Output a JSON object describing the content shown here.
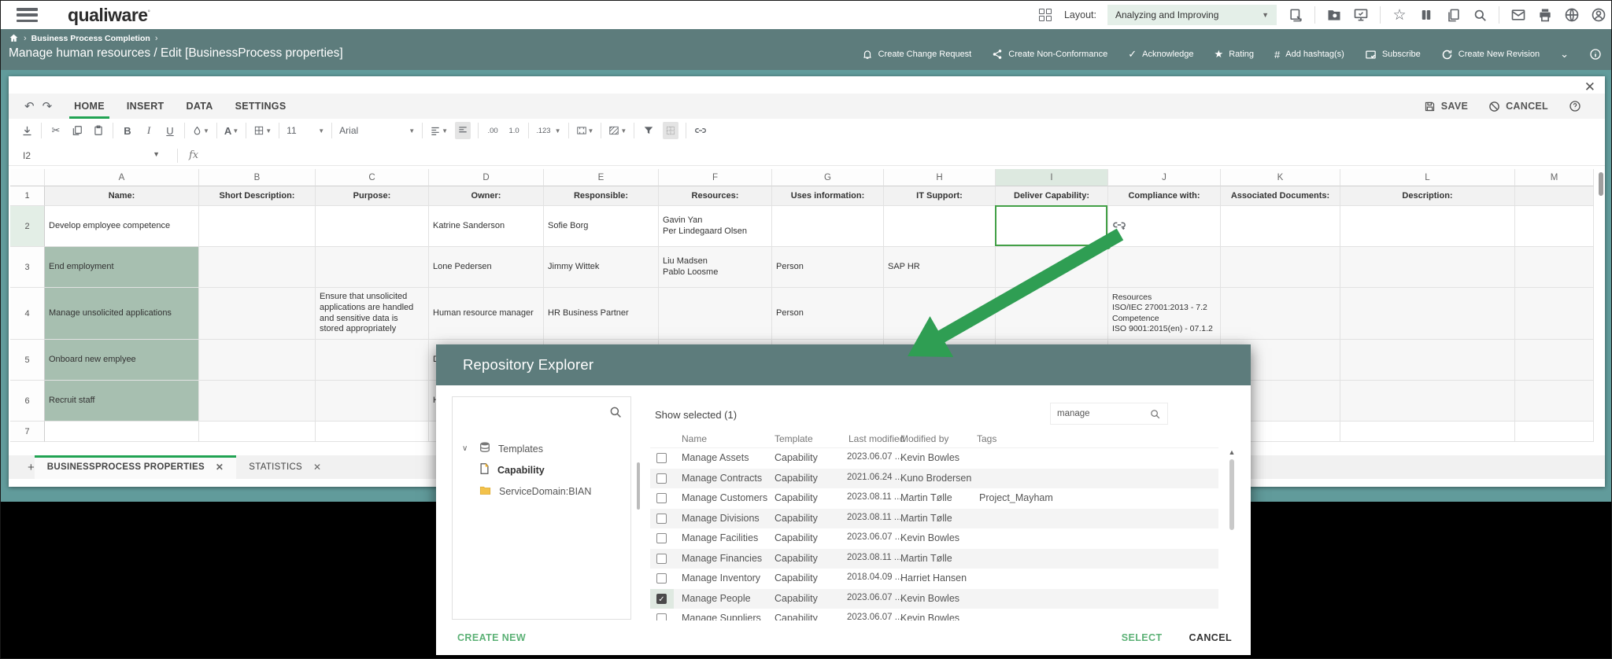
{
  "topbar": {
    "logo": "qualiware",
    "layout_label": "Layout:",
    "layout_value": "Analyzing and Improving"
  },
  "breadcrumb": {
    "path": "Business Process Completion"
  },
  "page": {
    "title": "Manage human resources / Edit [BusinessProcess properties]"
  },
  "actions": {
    "change_request": "Create Change Request",
    "non_conformance": "Create Non-Conformance",
    "acknowledge": "Acknowledge",
    "rating": "Rating",
    "hashtag": "Add hashtag(s)",
    "subscribe": "Subscribe",
    "new_revision": "Create New Revision"
  },
  "editor": {
    "tabs": [
      "HOME",
      "INSERT",
      "DATA",
      "SETTINGS"
    ],
    "active_tab": "HOME",
    "save_label": "SAVE",
    "cancel_label": "CANCEL",
    "font_size": "11",
    "font_name": "Arial",
    "number_format": ".123",
    "cell_ref": "I2",
    "fx_label": "fx",
    "add_sheet": "+",
    "sheet_tabs": [
      "BUSINESSPROCESS PROPERTIES",
      "STATISTICS"
    ],
    "grid": {
      "column_letters": [
        "A",
        "B",
        "C",
        "D",
        "E",
        "F",
        "G",
        "H",
        "I",
        "J",
        "K",
        "L",
        "M"
      ],
      "selected_cell": "I2",
      "headers": [
        "Name:",
        "Short Description:",
        "Purpose:",
        "Owner:",
        "Responsible:",
        "Resources:",
        "Uses information:",
        "IT Support:",
        "Deliver Capability:",
        "Compliance with:",
        "Associated Documents:",
        "Description:"
      ],
      "rows": [
        {
          "n": "2",
          "cells": {
            "A": "Develop employee competence",
            "D": "Katrine Sanderson",
            "E": "Sofie Borg",
            "F": "Gavin Yan\nPer Lindegaard Olsen"
          }
        },
        {
          "n": "3",
          "cells": {
            "A": "End employment",
            "D": "Lone Pedersen",
            "E": "Jimmy Wittek",
            "F": "Liu Madsen\nPablo Loosme",
            "G": "Person",
            "H": "SAP HR"
          }
        },
        {
          "n": "4",
          "cells": {
            "A": "Manage unsolicited applications",
            "C": "Ensure that unsolicited applications are handled and sensitive data is stored appropriately",
            "D": "Human resource manager",
            "E": "HR Business Partner",
            "G": "Person",
            "J": "Resources\nISO/IEC 27001:2013 - 7.2\nCompetence\nISO 9001:2015(en) - 07.1.2"
          }
        },
        {
          "n": "5",
          "cells": {
            "A": "Onboard new emplyee",
            "D": "Do"
          }
        },
        {
          "n": "6",
          "cells": {
            "A": "Recruit staff",
            "D": "He"
          }
        },
        {
          "n": "7",
          "cells": {}
        }
      ]
    }
  },
  "dialog": {
    "title": "Repository Explorer",
    "show_selected": "Show selected (1)",
    "search_value": "manage",
    "tree": [
      {
        "label": "Templates",
        "icon": "database-icon",
        "expanded": true,
        "selected": false
      },
      {
        "label": "Capability",
        "icon": "template-icon",
        "expanded": false,
        "selected": true
      },
      {
        "label": "ServiceDomain:BIAN",
        "icon": "folder-icon",
        "expanded": false,
        "selected": false
      }
    ],
    "columns": [
      "Name",
      "Template",
      "Last modified",
      "Modified by",
      "Tags"
    ],
    "rows": [
      {
        "name": "Manage Assets",
        "template": "Capability",
        "modified": "2023.06.07 ...",
        "by": "Kevin Bowles",
        "tags": "",
        "checked": false
      },
      {
        "name": "Manage Contracts",
        "template": "Capability",
        "modified": "2021.06.24 ...",
        "by": "Kuno Brodersen",
        "tags": "",
        "checked": false
      },
      {
        "name": "Manage Customers",
        "template": "Capability",
        "modified": "2023.08.11 ...",
        "by": "Martin Tølle",
        "tags": "Project_Mayham",
        "checked": false
      },
      {
        "name": "Manage Divisions",
        "template": "Capability",
        "modified": "2023.08.11 ...",
        "by": "Martin Tølle",
        "tags": "",
        "checked": false
      },
      {
        "name": "Manage Facilities",
        "template": "Capability",
        "modified": "2023.06.07 ...",
        "by": "Kevin Bowles",
        "tags": "",
        "checked": false
      },
      {
        "name": "Manage Financies",
        "template": "Capability",
        "modified": "2023.08.11 ...",
        "by": "Martin Tølle",
        "tags": "",
        "checked": false
      },
      {
        "name": "Manage Inventory",
        "template": "Capability",
        "modified": "2018.04.09 ...",
        "by": "Harriet Hansen",
        "tags": "",
        "checked": false
      },
      {
        "name": "Manage People",
        "template": "Capability",
        "modified": "2023.06.07 ...",
        "by": "Kevin Bowles",
        "tags": "",
        "checked": true
      },
      {
        "name": "Manage Suppliers",
        "template": "Capability",
        "modified": "2023.06.07 ...",
        "by": "Kevin Bowles",
        "tags": "",
        "checked": false
      }
    ],
    "buttons": {
      "create_new": "CREATE NEW",
      "select": "SELECT",
      "cancel": "CANCEL"
    }
  },
  "colors": {
    "band": "#5d7c7c",
    "page_teal": "#619b9b",
    "accent_green": "#21a353",
    "arrow_green": "#2f9e53",
    "sage_cell": "#a7bfb0",
    "selection_border": "#43a047",
    "layout_dropdown_bg": "#e4efe8"
  }
}
